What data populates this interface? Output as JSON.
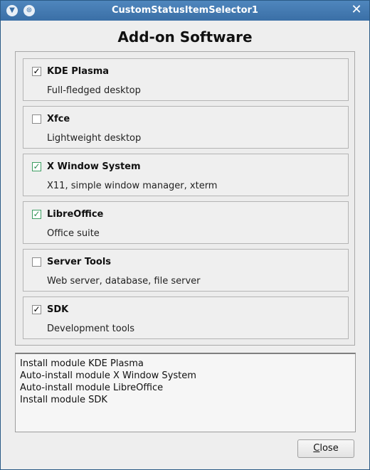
{
  "window": {
    "title": "CustomStatusItemSelector1",
    "menu_icon": "chevron-down-icon",
    "pin_icon": "pin-icon",
    "close_icon": "close-icon"
  },
  "heading": "Add-on Software",
  "items": [
    {
      "title": "KDE Plasma",
      "desc": "Full-fledged desktop",
      "state": "checked"
    },
    {
      "title": "Xfce",
      "desc": "Lightweight desktop",
      "state": "unchecked"
    },
    {
      "title": "X Window System",
      "desc": "X11, simple window manager, xterm",
      "state": "auto"
    },
    {
      "title": "LibreOffice",
      "desc": "Office suite",
      "state": "auto"
    },
    {
      "title": "Server Tools",
      "desc": "Web server, database, file server",
      "state": "unchecked"
    },
    {
      "title": "SDK",
      "desc": "Development tools",
      "state": "checked"
    }
  ],
  "log_lines": [
    "Install module KDE Plasma",
    "Auto-install module X Window System",
    "Auto-install module LibreOffice",
    "Install module SDK"
  ],
  "close_button": {
    "mnemonic": "C",
    "rest": "lose"
  },
  "colors": {
    "titlebar": "#3a6fa6",
    "auto_check": "#2f8f55"
  }
}
